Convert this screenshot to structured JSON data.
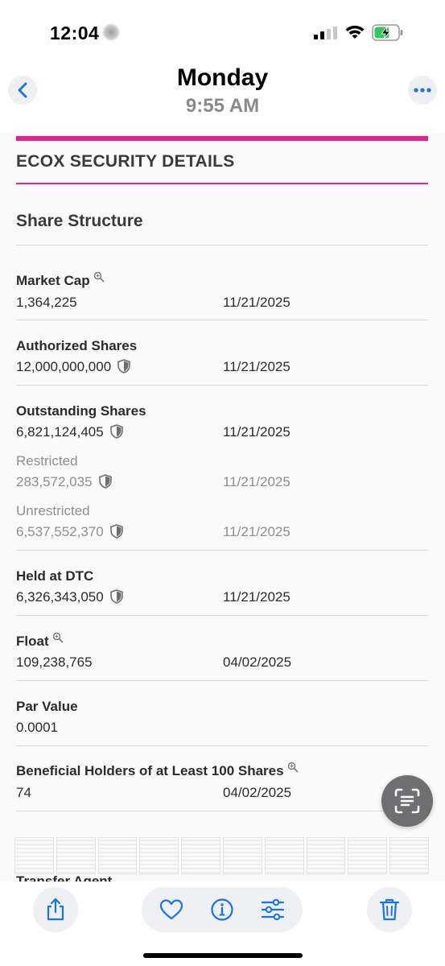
{
  "status_bar": {
    "time": "12:04",
    "icons": [
      "dnd-icon",
      "signal-icon",
      "wifi-icon",
      "battery-charging-icon"
    ]
  },
  "nav": {
    "title": "Monday",
    "subtitle": "9:55 AM",
    "back_icon": "chevron-left-icon",
    "more_icon": "ellipsis-icon"
  },
  "section": {
    "title": "ECOX SECURITY DETAILS",
    "subtitle": "Share Structure"
  },
  "rows": [
    {
      "label": "Market Cap",
      "value": "1,364,225",
      "date": "11/21/2025",
      "icon": "magnify-icon"
    },
    {
      "label": "Authorized Shares",
      "value": "12,000,000,000",
      "date": "11/21/2025",
      "icon": "shield-icon"
    },
    {
      "label": "Outstanding Shares",
      "value": "6,821,124,405",
      "date": "11/21/2025",
      "icon": "shield-icon"
    },
    {
      "label": "Restricted",
      "value": "283,572,035",
      "date": "11/21/2025",
      "icon": "shield-icon"
    },
    {
      "label": "Unrestricted",
      "value": "6,537,552,370",
      "date": "11/21/2025",
      "icon": "shield-icon"
    },
    {
      "label": "Held at DTC",
      "value": "6,326,343,050",
      "date": "11/21/2025",
      "icon": "shield-icon"
    },
    {
      "label": "Float",
      "value": "109,238,765",
      "date": "04/02/2025",
      "icon": "magnify-icon"
    },
    {
      "label": "Par Value",
      "value": "0.0001",
      "date": ""
    },
    {
      "label": "Beneficial Holders of at Least 100 Shares",
      "value": "74",
      "date": "04/02/2025",
      "icon": "magnify-icon"
    }
  ],
  "peek_text": "Transfer Agent",
  "toolbar": {
    "icons": [
      "share-icon",
      "heart-icon",
      "info-icon",
      "adjust-icon",
      "trash-icon"
    ]
  },
  "colors": {
    "accent": "#ea1f8e",
    "ios_blue": "#1a73e8"
  }
}
